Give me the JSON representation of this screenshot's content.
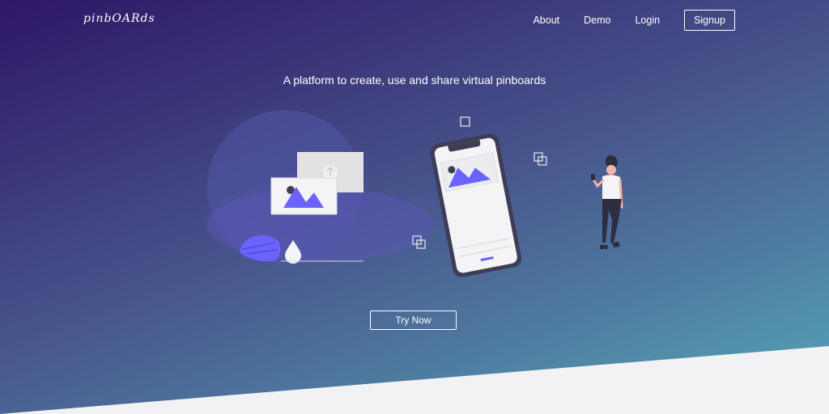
{
  "brand": {
    "logo_text": "pinbOARds"
  },
  "nav": {
    "items": [
      {
        "label": "About"
      },
      {
        "label": "Demo"
      },
      {
        "label": "Login"
      }
    ],
    "signup_label": "Signup"
  },
  "hero": {
    "tagline": "A platform to create, use and share virtual pinboards",
    "cta_label": "Try Now"
  },
  "colors": {
    "accent": "#6c63ff",
    "gradient_start": "#2e1767",
    "gradient_end": "#55a8b9",
    "wedge": "#f2f2f4"
  }
}
